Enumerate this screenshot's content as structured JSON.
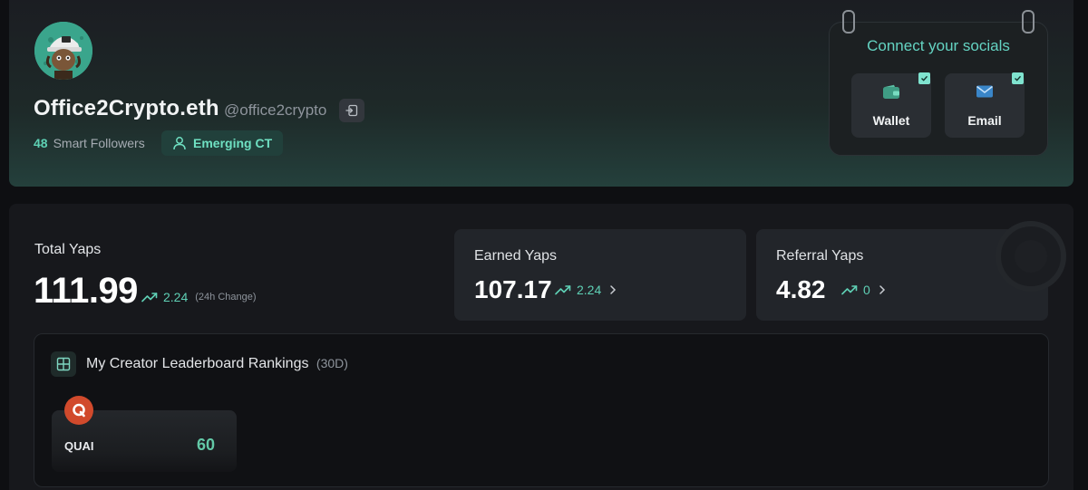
{
  "profile": {
    "display_name": "Office2Crypto.eth",
    "handle": "@office2crypto",
    "smart_followers_count": "48",
    "smart_followers_label": "Smart Followers",
    "tier_badge": "Emerging CT"
  },
  "socials": {
    "title": "Connect your socials",
    "items": [
      {
        "label": "Wallet",
        "icon": "wallet-icon",
        "connected": true
      },
      {
        "label": "Email",
        "icon": "mail-icon",
        "connected": true
      }
    ]
  },
  "stats": {
    "total": {
      "label": "Total Yaps",
      "value": "111.99",
      "change": "2.24",
      "change_note": "(24h Change)"
    },
    "earned": {
      "label": "Earned Yaps",
      "value": "107.17",
      "change": "2.24"
    },
    "referral": {
      "label": "Referral Yaps",
      "value": "4.82",
      "change": "0"
    }
  },
  "leaderboard": {
    "title": "My Creator Leaderboard Rankings",
    "period": "(30D)",
    "entries": [
      {
        "name": "QUAI",
        "rank": "60"
      }
    ]
  },
  "colors": {
    "accent": "#5fd0b5",
    "background": "#0e0f12",
    "card": "#22252a",
    "quai_brand": "#d14a2c"
  }
}
